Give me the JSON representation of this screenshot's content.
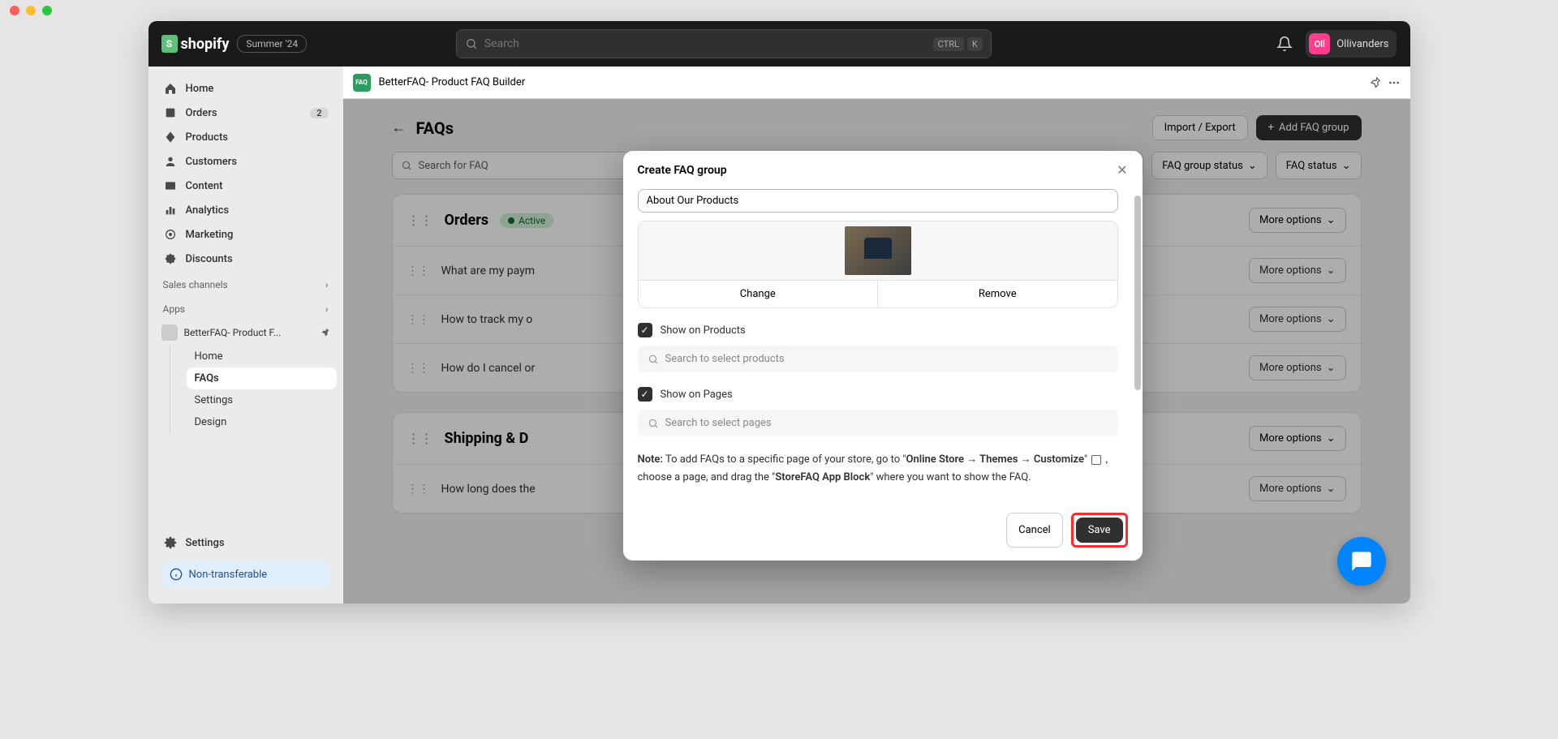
{
  "header": {
    "brand": "shopify",
    "edition_badge": "Summer '24",
    "search_placeholder": "Search",
    "kbd_ctrl": "CTRL",
    "kbd_k": "K",
    "user_initials": "Oll",
    "user_name": "Ollivanders"
  },
  "sidebar": {
    "home": "Home",
    "orders": "Orders",
    "orders_count": "2",
    "products": "Products",
    "customers": "Customers",
    "content": "Content",
    "analytics": "Analytics",
    "marketing": "Marketing",
    "discounts": "Discounts",
    "sales_channels": "Sales channels",
    "apps": "Apps",
    "app_name": "BetterFAQ- Product F...",
    "sub_home": "Home",
    "sub_faqs": "FAQs",
    "sub_settings": "Settings",
    "sub_design": "Design",
    "settings": "Settings",
    "non_transferable": "Non-transferable"
  },
  "appbar": {
    "title": "BetterFAQ- Product FAQ Builder",
    "icon_text": "FAQ"
  },
  "page": {
    "title": "FAQs",
    "import_export": "Import / Export",
    "add_group": "Add FAQ group",
    "search_placeholder": "Search for FAQ",
    "group_status": "FAQ group status",
    "faq_status": "FAQ status",
    "more_options": "More options"
  },
  "groups": [
    {
      "title": "Orders",
      "status": "Active",
      "faqs": [
        "What are my paym",
        "How to track my o",
        "How do I cancel or"
      ]
    },
    {
      "title": "Shipping & D",
      "status": "",
      "faqs": [
        "How long does the"
      ]
    }
  ],
  "modal": {
    "title": "Create FAQ group",
    "input_value": "About Our Products",
    "change": "Change",
    "remove": "Remove",
    "show_products": "Show on Products",
    "products_placeholder": "Search to select products",
    "show_pages": "Show on Pages",
    "pages_placeholder": "Search to select pages",
    "note_label": "Note:",
    "note_1": " To add FAQs to a specific page of your store, go to \"",
    "note_bold_1": "Online Store → Themes → Customize",
    "note_2": "\" ",
    "note_3": " , choose a page, and drag the \"",
    "note_bold_2": "StoreFAQ App Block",
    "note_4": "\" where you want to show the FAQ.",
    "cancel": "Cancel",
    "save": "Save"
  }
}
